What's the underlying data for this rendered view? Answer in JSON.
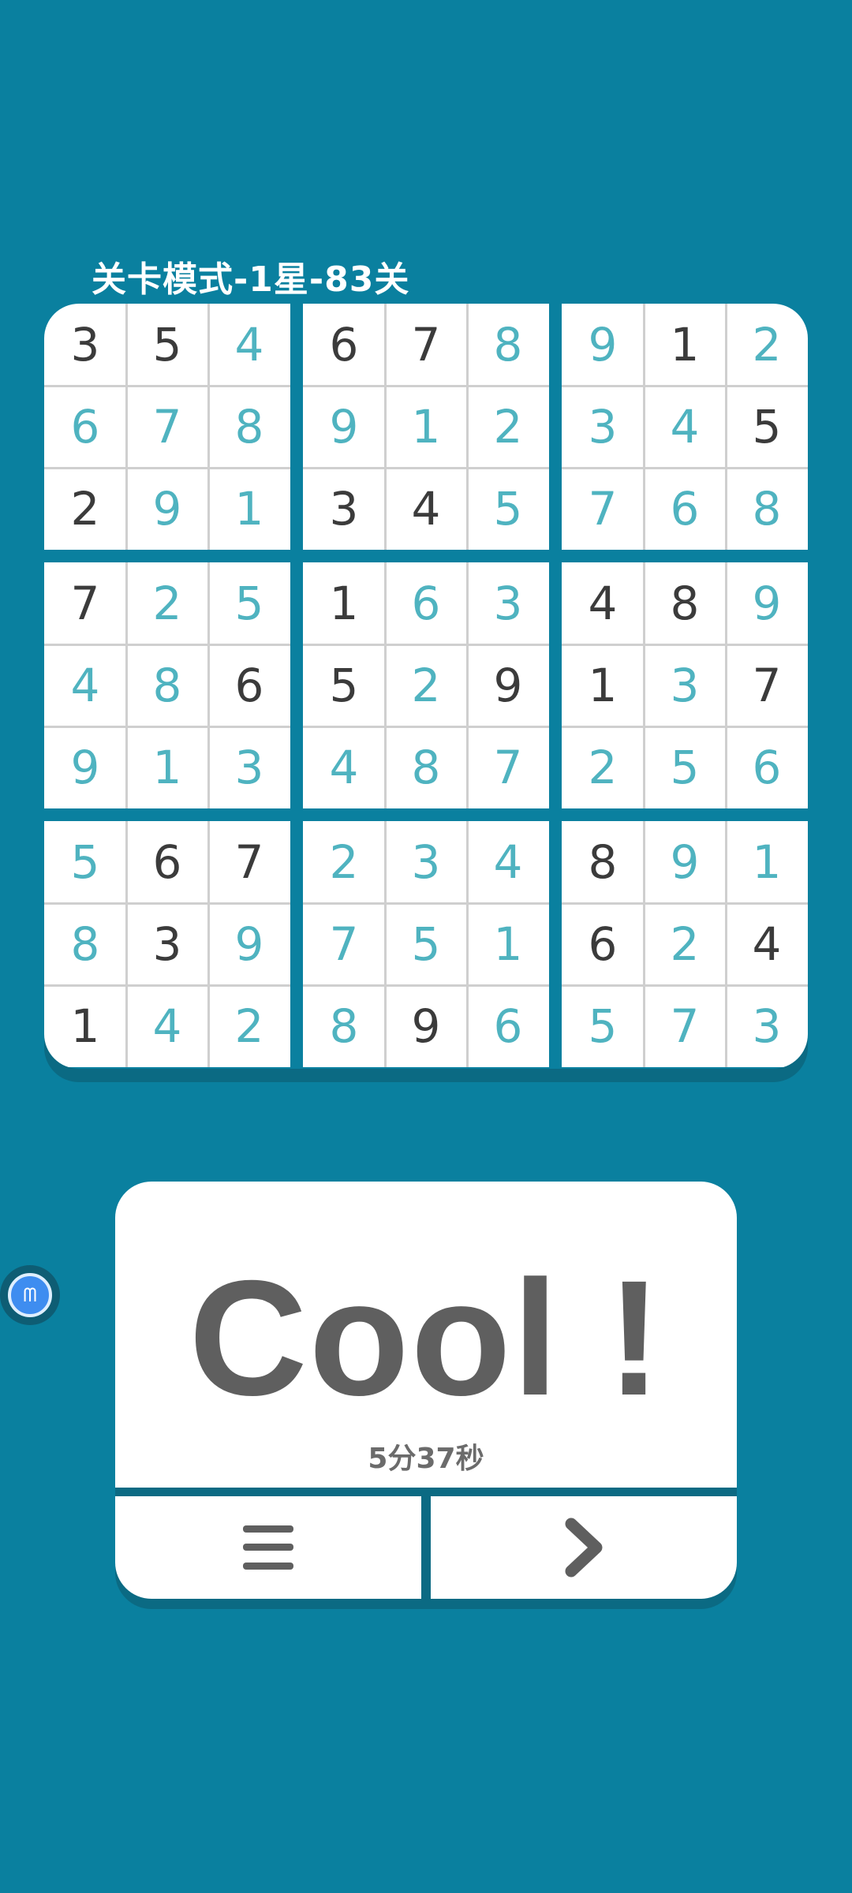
{
  "header": {
    "level_title": "关卡模式-1星-83关"
  },
  "board": {
    "values": [
      [
        3,
        5,
        4,
        6,
        7,
        8,
        9,
        1,
        2
      ],
      [
        6,
        7,
        8,
        9,
        1,
        2,
        3,
        4,
        5
      ],
      [
        2,
        9,
        1,
        3,
        4,
        5,
        7,
        6,
        8
      ],
      [
        7,
        2,
        5,
        1,
        6,
        3,
        4,
        8,
        9
      ],
      [
        4,
        8,
        6,
        5,
        2,
        9,
        1,
        3,
        7
      ],
      [
        9,
        1,
        3,
        4,
        8,
        7,
        2,
        5,
        6
      ],
      [
        5,
        6,
        7,
        2,
        3,
        4,
        8,
        9,
        1
      ],
      [
        8,
        3,
        9,
        7,
        5,
        1,
        6,
        2,
        4
      ],
      [
        1,
        4,
        2,
        8,
        9,
        6,
        5,
        7,
        3
      ]
    ],
    "given_mask": [
      [
        1,
        1,
        0,
        1,
        1,
        0,
        0,
        1,
        0
      ],
      [
        0,
        0,
        0,
        0,
        0,
        0,
        0,
        0,
        1
      ],
      [
        1,
        0,
        0,
        1,
        1,
        0,
        0,
        0,
        0
      ],
      [
        1,
        0,
        0,
        1,
        0,
        0,
        1,
        1,
        0
      ],
      [
        0,
        0,
        1,
        1,
        0,
        1,
        1,
        0,
        1
      ],
      [
        0,
        0,
        0,
        0,
        0,
        0,
        0,
        0,
        0
      ],
      [
        0,
        1,
        1,
        0,
        0,
        0,
        1,
        0,
        0
      ],
      [
        0,
        1,
        0,
        0,
        0,
        0,
        1,
        0,
        1
      ],
      [
        1,
        0,
        0,
        0,
        1,
        0,
        0,
        0,
        0
      ]
    ],
    "given_color": "#3b3b3b",
    "filled_color": "#4fb3c0"
  },
  "result": {
    "title": "Cool !",
    "time": "5分37秒"
  },
  "actions": {
    "menu_icon": "menu-icon",
    "next_icon": "chevron-right-icon"
  },
  "colors": {
    "background": "#0a809f",
    "card": "#ffffff",
    "text_dark": "#5f5f5f"
  }
}
